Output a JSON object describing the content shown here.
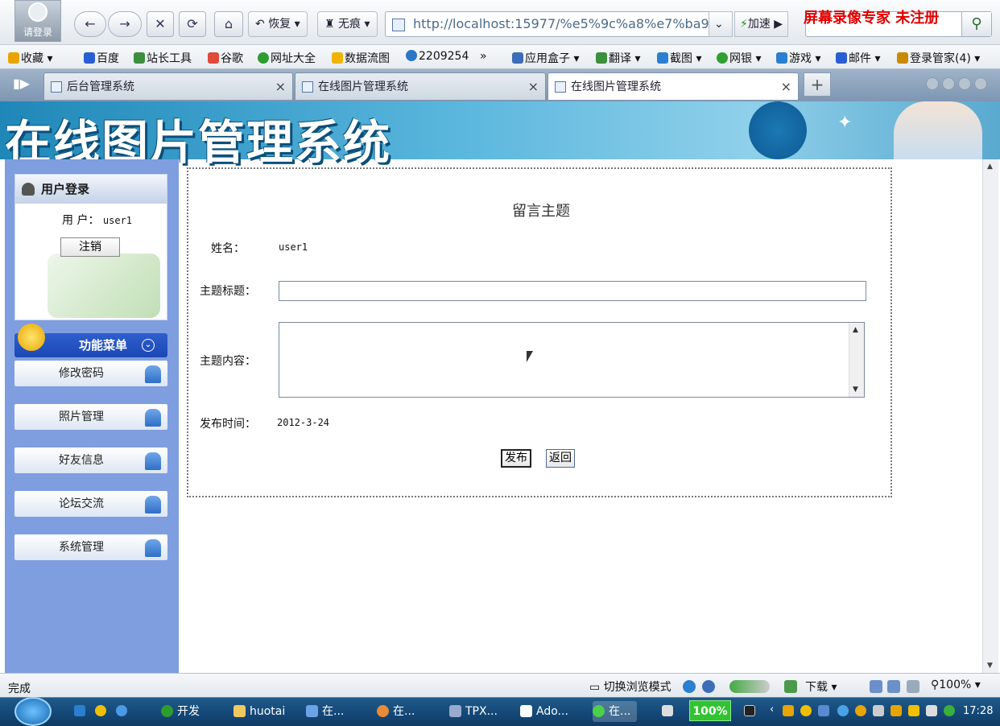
{
  "browser": {
    "login_avatar_label": "请登录",
    "restore_label": "恢复",
    "incognito_label": "无痕",
    "address": "http://localhost:15977/%e5%9c%a8%e7%ba9",
    "accelerate_label": "加速",
    "watermark": "屏幕录像专家 未注册",
    "favorites": [
      {
        "label": "收藏",
        "color": "#e8a400"
      },
      {
        "label": "百度",
        "color": "#2b5fd1"
      },
      {
        "label": "站长工具",
        "color": "#3c8f3c"
      },
      {
        "label": "谷歌",
        "color": "#e04a3a"
      },
      {
        "label": "网址大全",
        "color": "#2f9c2f"
      },
      {
        "label": "数据流图",
        "color": "#f0b400"
      },
      {
        "label": "2209254",
        "color": "#2a78c8"
      },
      {
        "label": "»",
        "color": ""
      },
      {
        "label": "应用盒子",
        "color": "#3d6cb8"
      },
      {
        "label": "翻译",
        "color": "#3c8f3c"
      },
      {
        "label": "截图",
        "color": "#2b7fd1"
      },
      {
        "label": "网银",
        "color": "#30a030"
      },
      {
        "label": "游戏",
        "color": "#2b7fd1"
      },
      {
        "label": "邮件",
        "color": "#2b5fd1"
      },
      {
        "label": "登录管家(4)",
        "color": "#c88a00"
      }
    ],
    "tabs": [
      {
        "label": "后台管理系统"
      },
      {
        "label": "在线图片管理系统"
      },
      {
        "label": "在线图片管理系统"
      }
    ],
    "status_text": "完成",
    "switch_mode_label": "切换浏览模式",
    "downloads_label": "下载",
    "zoom_label": "100%"
  },
  "banner": {
    "title": "在线图片管理系统"
  },
  "sidebar": {
    "login_title": "用户登录",
    "user_label": "用 户：",
    "username": "user1",
    "logout_label": "注销",
    "menu_title": "功能菜单",
    "menu_items": [
      {
        "label": "修改密码"
      },
      {
        "label": "照片管理"
      },
      {
        "label": "好友信息"
      },
      {
        "label": "论坛交流"
      },
      {
        "label": "系统管理"
      }
    ]
  },
  "form": {
    "title": "留言主题",
    "name_label": "姓名：",
    "name_value": "user1",
    "subject_label": "主题标题：",
    "subject_value": "",
    "content_label": "主题内容：",
    "content_value": "",
    "date_label": "发布时间：",
    "date_value": "2012-3-24",
    "publish_label": "发布",
    "back_label": "返回"
  },
  "taskbar": {
    "items": [
      {
        "label": "开发"
      },
      {
        "label": "huotai"
      },
      {
        "label": "在..."
      },
      {
        "label": "在..."
      },
      {
        "label": "TPX..."
      },
      {
        "label": "Ado..."
      },
      {
        "label": "在..."
      }
    ],
    "percent": "100%",
    "clock": "17:28"
  }
}
